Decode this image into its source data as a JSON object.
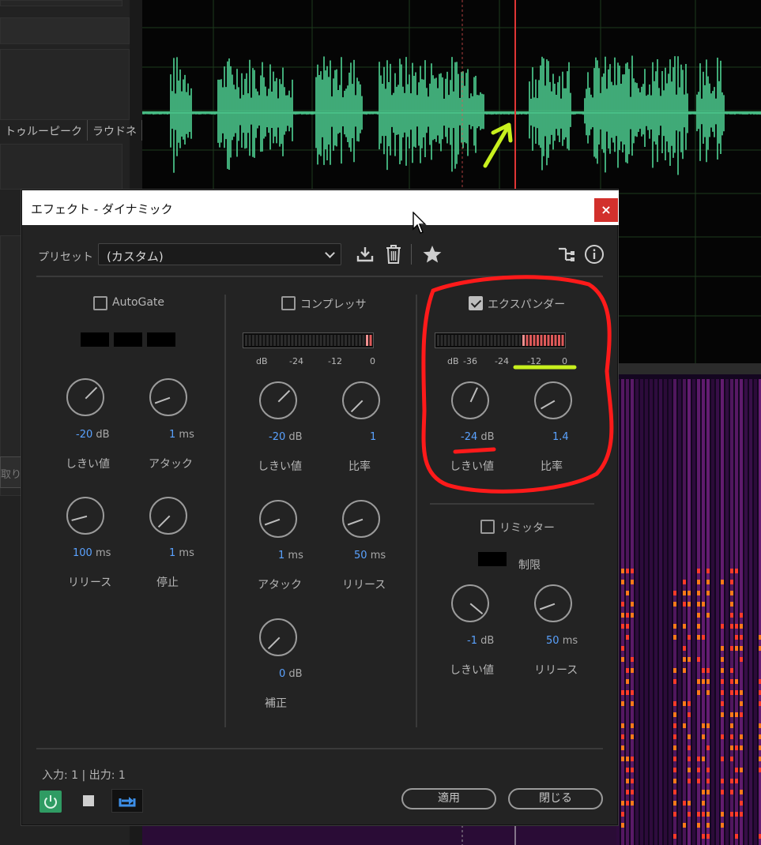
{
  "bg": {
    "tabs": [
      "トゥルーピーク",
      "ラウドネ"
    ],
    "side_btn": "取り消"
  },
  "dialog": {
    "title": "エフェクト - ダイナミック",
    "close_glyph": "×",
    "preset_label": "プリセット :",
    "preset_value": "(カスタム)",
    "autogate": {
      "label": "AutoGate",
      "checked": false,
      "knobs": [
        {
          "value": "-20",
          "unit": "dB",
          "label": "しきい値"
        },
        {
          "value": "1",
          "unit": "ms",
          "label": "アタック"
        },
        {
          "value": "100",
          "unit": "ms",
          "label": "リリース"
        },
        {
          "value": "1",
          "unit": "ms",
          "label": "停止"
        }
      ]
    },
    "compressor": {
      "label": "コンプレッサ",
      "checked": false,
      "meter_ticks": [
        "dB",
        "-24",
        "-12",
        "0"
      ],
      "knobs": [
        {
          "value": "-20",
          "unit": "dB",
          "label": "しきい値"
        },
        {
          "value": "1",
          "unit": "",
          "label": "比率"
        },
        {
          "value": "1",
          "unit": "ms",
          "label": "アタック"
        },
        {
          "value": "50",
          "unit": "ms",
          "label": "リリース"
        },
        {
          "value": "0",
          "unit": "dB",
          "label": "補正"
        }
      ]
    },
    "expander": {
      "label": "エクスパンダー",
      "checked": true,
      "meter_ticks": [
        "dB",
        "-36",
        "-24",
        "-12",
        "0"
      ],
      "knobs": [
        {
          "value": "-24",
          "unit": "dB",
          "label": "しきい値"
        },
        {
          "value": "1.4",
          "unit": "",
          "label": "比率"
        }
      ]
    },
    "limiter": {
      "label": "リミッター",
      "checked": false,
      "limit_label": "制限",
      "knobs": [
        {
          "value": "-1",
          "unit": "dB",
          "label": "しきい値"
        },
        {
          "value": "50",
          "unit": "ms",
          "label": "リリース"
        }
      ]
    },
    "io_label": "入力: 1 | 出力: 1",
    "apply_label": "適用",
    "close_label": "閉じる"
  },
  "colors": {
    "waveform": "#4fd394",
    "accent_blue": "#5aa2ff",
    "power_green": "#2f9b63",
    "annotation_red": "#ff1a1a",
    "annotation_yellow": "#c8f01e"
  },
  "icons": [
    "download-icon",
    "trash-icon",
    "star-icon",
    "routing-icon",
    "info-icon",
    "power-icon",
    "stop-icon",
    "loop-icon",
    "cursor-icon"
  ]
}
